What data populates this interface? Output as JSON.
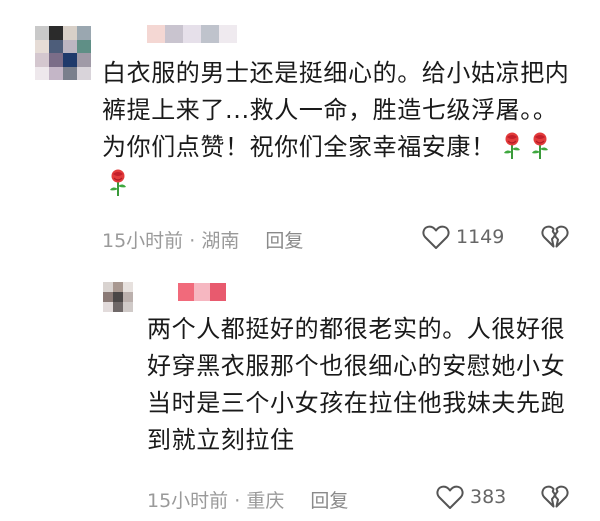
{
  "comments": [
    {
      "text": "白衣服的男士还是挺细心的。给小姑凉把内裤提上来了...救人一命，胜造七级浮屠。。为你们点赞！祝你们全家幸福安康！",
      "emoji": "rose",
      "time": "15小时前",
      "location": "湖南",
      "reply_label": "回复",
      "likes": "1149",
      "avatar_colors": [
        "#c9c9c9",
        "#2b2b2b",
        "#d8d0c8",
        "#9aa7b0",
        "#e6dcd6",
        "#4d5d7a",
        "#bcb6c2",
        "#5f8f86",
        "#d4c7cf",
        "#7b6d88",
        "#1f3a6b",
        "#a09aa7",
        "#eee8ec",
        "#c4b6c7",
        "#7a7f8c",
        "#d9d4da"
      ],
      "name_colors": [
        "#f4d7d3",
        "#c9c4cf",
        "#e6e0ea",
        "#bfc3cc",
        "#efeaef"
      ]
    },
    {
      "text": "两个人都挺好的都很老实的。人很好很好穿黑衣服那个也很细心的安慰她小女当时是三个小女孩在拉住他我妹夫先跑到就立刻拉住",
      "time": "15小时前",
      "location": "重庆",
      "reply_label": "回复",
      "likes": "383",
      "avatar_colors": [
        "#d9d3d0",
        "#a89890",
        "#e7e1de",
        "#8a7a76",
        "#4a4646",
        "#bbb0ad",
        "#e2dbdb",
        "#6f6868",
        "#d0cac8"
      ],
      "name_colors": [
        "#f16a7b",
        "#f6b7c1",
        "#e85a6e"
      ]
    }
  ],
  "meta_separator": " · ",
  "icons": {
    "like": "heart-outline-icon",
    "dislike": "broken-heart-icon",
    "rose": "rose-emoji-icon"
  }
}
